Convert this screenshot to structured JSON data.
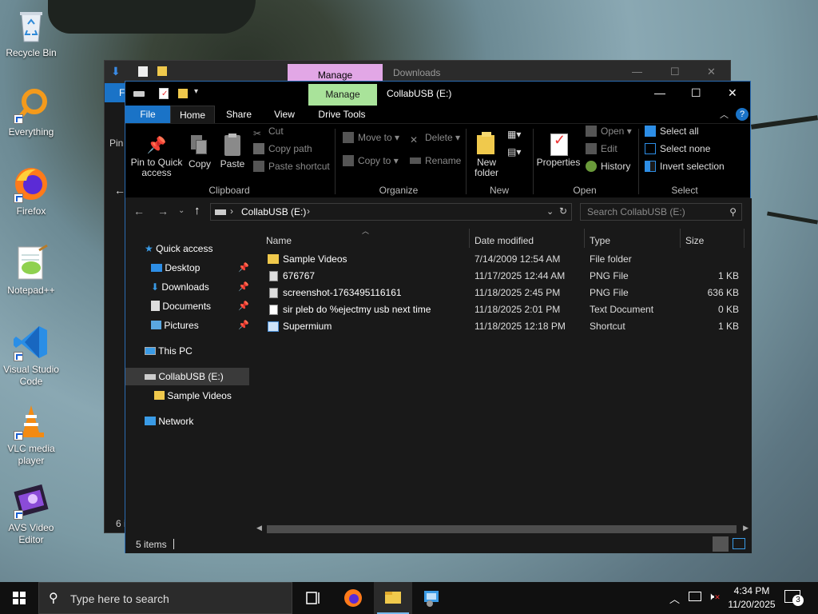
{
  "desktop": {
    "icons": [
      {
        "label": "Recycle Bin"
      },
      {
        "label": "Everything"
      },
      {
        "label": "Firefox"
      },
      {
        "label": "Notepad++"
      },
      {
        "label": "Visual Studio Code"
      },
      {
        "label": "VLC media player"
      },
      {
        "label": "AVS Video Editor"
      }
    ]
  },
  "back_window": {
    "manage_tab": "Manage",
    "title": "Downloads",
    "file_tab": "F",
    "pin_label": "Pin",
    "status": "6 i"
  },
  "window": {
    "manage_tab": "Manage",
    "title": "CollabUSB (E:)",
    "tabs": [
      "File",
      "Home",
      "Share",
      "View",
      "Drive Tools"
    ],
    "ribbon": {
      "clipboard": {
        "label": "Clipboard",
        "pin": "Pin to Quick access",
        "copy": "Copy",
        "paste": "Paste",
        "cut": "Cut",
        "copy_path": "Copy path",
        "paste_shortcut": "Paste shortcut"
      },
      "organize": {
        "label": "Organize",
        "move_to": "Move to",
        "copy_to": "Copy to",
        "delete": "Delete",
        "rename": "Rename"
      },
      "new": {
        "label": "New",
        "new_folder": "New folder"
      },
      "open": {
        "label": "Open",
        "properties": "Properties",
        "open": "Open",
        "edit": "Edit",
        "history": "History"
      },
      "select": {
        "label": "Select",
        "select_all": "Select all",
        "select_none": "Select none",
        "invert": "Invert selection"
      }
    },
    "address": {
      "path": "CollabUSB (E:)"
    },
    "search": {
      "placeholder": "Search CollabUSB (E:)"
    },
    "nav": [
      {
        "label": "Quick access",
        "pinned": false
      },
      {
        "label": "Desktop",
        "pinned": true
      },
      {
        "label": "Downloads",
        "pinned": true
      },
      {
        "label": "Documents",
        "pinned": true
      },
      {
        "label": "Pictures",
        "pinned": true
      },
      {
        "label": "This PC",
        "pinned": false
      },
      {
        "label": "CollabUSB (E:)",
        "pinned": false
      },
      {
        "label": "Sample Videos",
        "pinned": false
      },
      {
        "label": "Network",
        "pinned": false
      }
    ],
    "columns": [
      "Name",
      "Date modified",
      "Type",
      "Size"
    ],
    "files": [
      {
        "name": "Sample Videos",
        "date": "7/14/2009 12:54 AM",
        "type": "File folder",
        "size": "",
        "icon": "folder"
      },
      {
        "name": "676767",
        "date": "11/17/2025 12:44 AM",
        "type": "PNG File",
        "size": "1 KB",
        "icon": "image"
      },
      {
        "name": "screenshot-1763495116161",
        "date": "11/18/2025 2:45 PM",
        "type": "PNG File",
        "size": "636 KB",
        "icon": "image"
      },
      {
        "name": "sir pleb do %ejectmy usb next time",
        "date": "11/18/2025 2:01 PM",
        "type": "Text Document",
        "size": "0 KB",
        "icon": "text"
      },
      {
        "name": "Supermium",
        "date": "11/18/2025 12:18 PM",
        "type": "Shortcut",
        "size": "1 KB",
        "icon": "shortcut"
      }
    ],
    "status": "5 items"
  },
  "taskbar": {
    "search_placeholder": "Type here to search",
    "time": "4:34 PM",
    "date": "11/20/2025",
    "notifications": "3"
  }
}
